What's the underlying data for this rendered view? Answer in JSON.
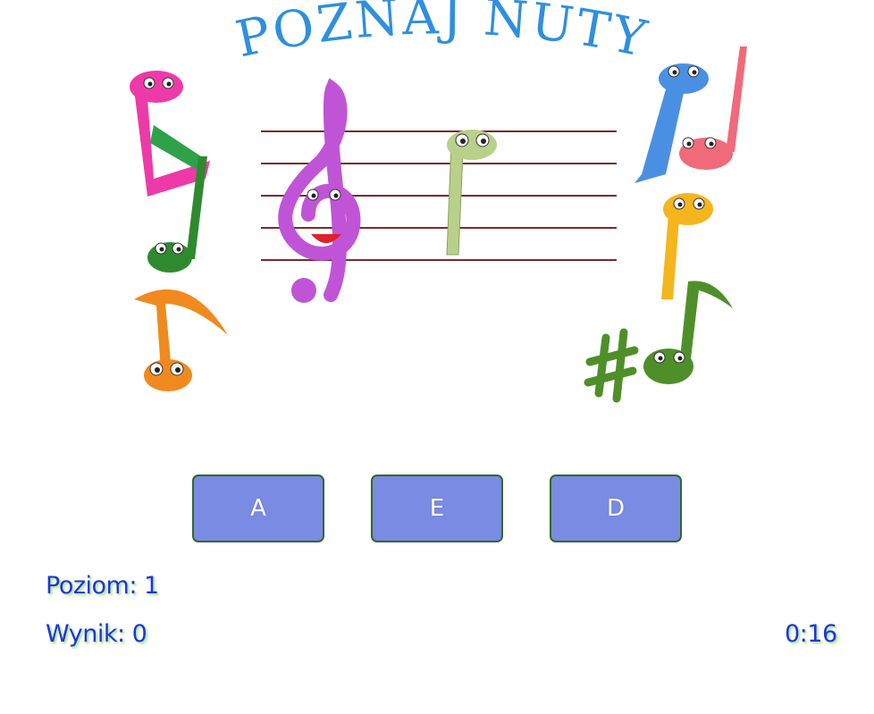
{
  "title": "POZNAJ NUTY",
  "answers": [
    {
      "label": "A"
    },
    {
      "label": "E"
    },
    {
      "label": "D"
    }
  ],
  "status": {
    "level_label": "Poziom: 1",
    "score_label": "Wynik: 0",
    "timer": "0:16"
  },
  "colors": {
    "title": "#2f8fdf",
    "button": "#7a8be3",
    "button_border": "#2f6a2a",
    "hud_text": "#1f35d8",
    "staff_lines": "#7a2a2a"
  },
  "icons": [
    "treble-clef-icon",
    "quarter-note-icon",
    "eighth-note-icon",
    "sharp-icon",
    "beamed-notes-icon"
  ]
}
